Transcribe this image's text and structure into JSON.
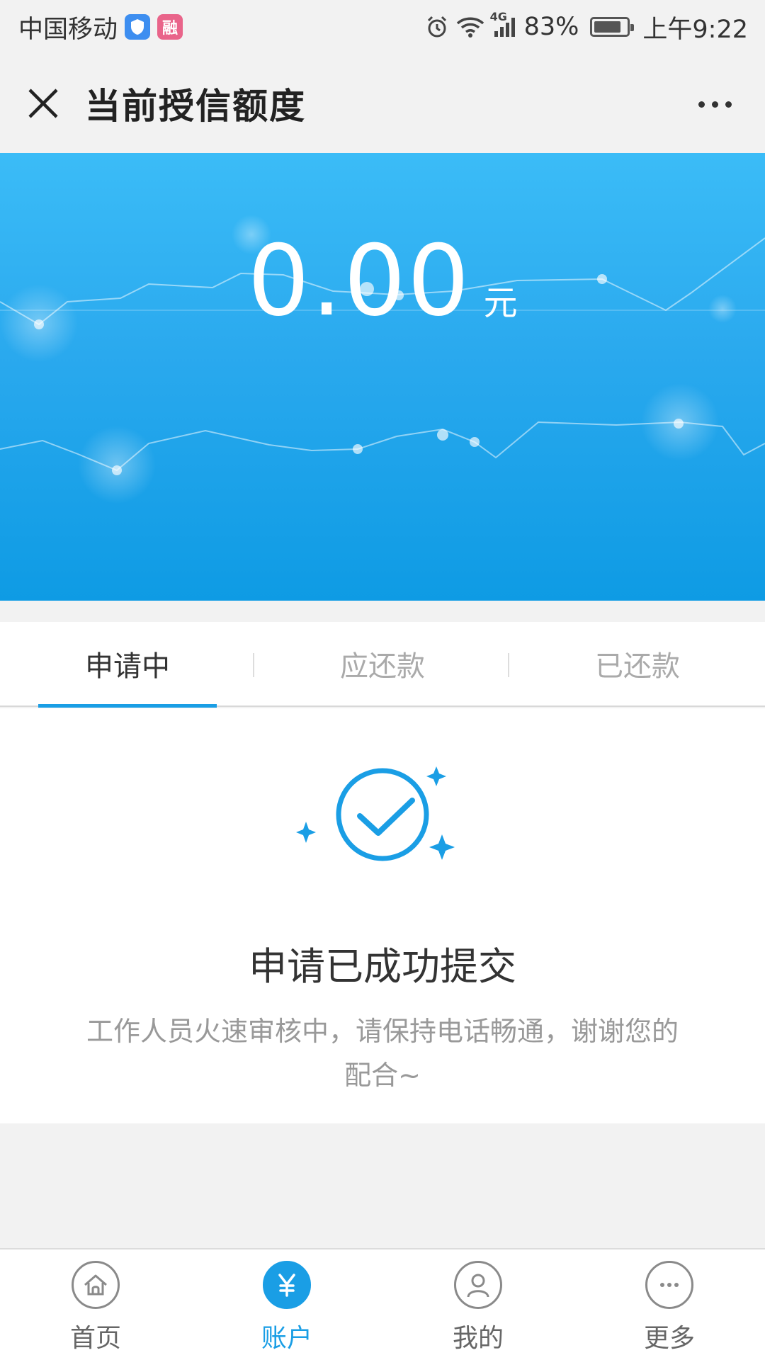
{
  "status_bar": {
    "carrier": "中国移动",
    "app_badge_2": "融",
    "network": "4G",
    "battery": "83%",
    "battery_level": 0.83,
    "time": "上午9:22"
  },
  "header": {
    "title": "当前授信额度"
  },
  "banner": {
    "amount": "0.00",
    "unit": "元"
  },
  "tabs": [
    {
      "label": "申请中",
      "active": true
    },
    {
      "label": "应还款",
      "active": false
    },
    {
      "label": "已还款",
      "active": false
    }
  ],
  "result": {
    "title": "申请已成功提交",
    "description": "工作人员火速审核中，请保持电话畅通，谢谢您的配合~"
  },
  "bottom_nav": [
    {
      "label": "首页",
      "icon": "home-icon",
      "active": false
    },
    {
      "label": "账户",
      "icon": "yen-icon",
      "active": true
    },
    {
      "label": "我的",
      "icon": "user-icon",
      "active": false
    },
    {
      "label": "更多",
      "icon": "more-icon",
      "active": false
    }
  ],
  "colors": {
    "accent": "#1a9ee5",
    "banner_top": "#3bbcf7",
    "banner_bottom": "#0e9be4"
  }
}
